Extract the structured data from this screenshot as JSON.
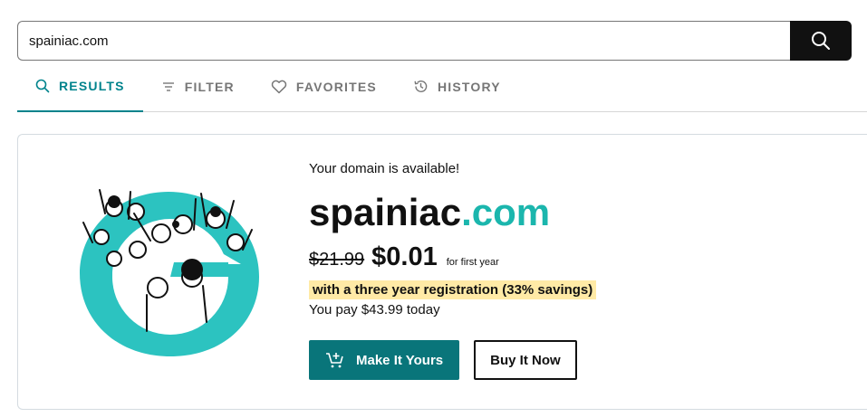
{
  "search": {
    "value": "spainiac.com",
    "button_icon": "search-icon"
  },
  "tabs": [
    {
      "label": "RESULTS",
      "icon": "search-icon",
      "active": true
    },
    {
      "label": "FILTER",
      "icon": "filter-icon",
      "active": false
    },
    {
      "label": "FAVORITES",
      "icon": "heart-icon",
      "active": false
    },
    {
      "label": "HISTORY",
      "icon": "history-icon",
      "active": false
    }
  ],
  "result": {
    "availability_text": "Your domain is available!",
    "domain_base": "spainiac",
    "domain_tld": ".com",
    "old_price": "$21.99",
    "new_price": "$0.01",
    "price_note": "for first year",
    "savings_text": "with a three year registration (33% savings)",
    "you_pay_text": "You pay $43.99 today",
    "primary_button": "Make It Yours",
    "primary_button_icon": "cart-plus-icon",
    "secondary_button": "Buy It Now",
    "illustration": "crowd-celebrating-illustration"
  },
  "colors": {
    "accent_teal": "#1bb6ad",
    "button_teal": "#09757a",
    "highlight": "#ffeaa6",
    "active_tab_underline": "#00838c",
    "search_button": "#111111"
  }
}
